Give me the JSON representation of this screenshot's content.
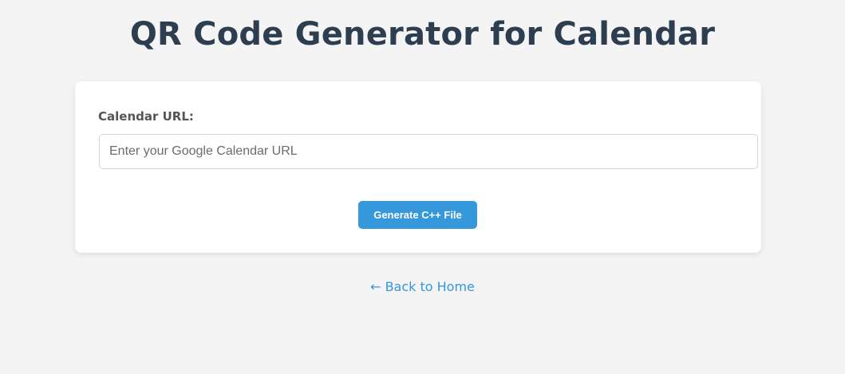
{
  "header": {
    "title": "QR Code Generator for Calendar"
  },
  "form": {
    "url_label": "Calendar URL:",
    "url_value": "",
    "url_placeholder": "Enter your Google Calendar URL",
    "generate_label": "Generate C++ File"
  },
  "footer": {
    "back_link_label": "← Back to Home"
  },
  "colors": {
    "background": "#f4f4f4",
    "title": "#2c3e50",
    "accent": "#3498db",
    "card": "#ffffff"
  }
}
